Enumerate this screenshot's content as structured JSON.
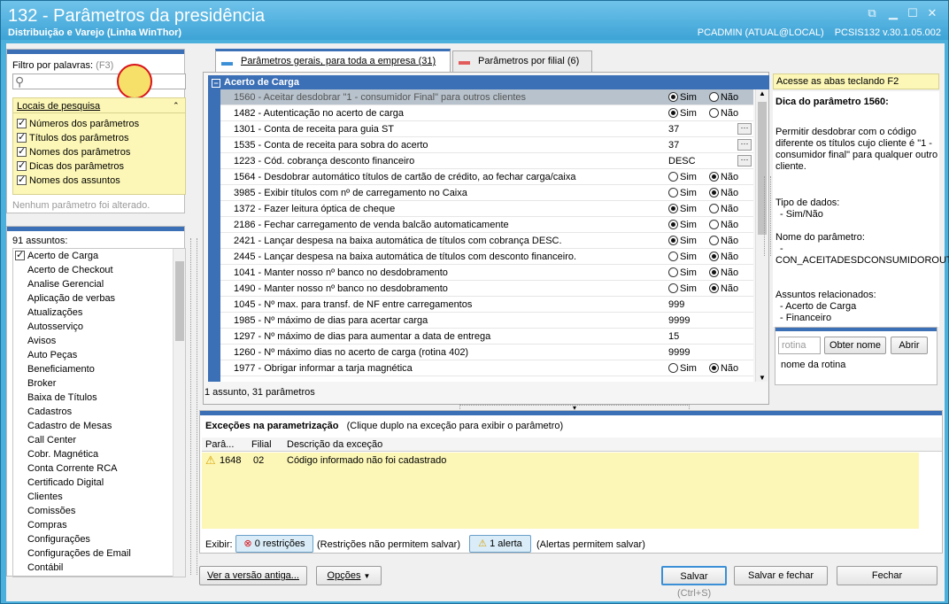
{
  "window": {
    "title": "132 - Parâmetros da presidência",
    "subtitle": "Distribuição e Varejo (Linha WinThor)",
    "user": "PCADMIN (ATUAL@LOCAL)",
    "version": "PCSIS132  v.30.1.05.002"
  },
  "filter": {
    "label": "Filtro por palavras:",
    "shortcut": "(F3)",
    "value": "",
    "locais_title": "Locais de pesquisa",
    "options": [
      {
        "label": "Números dos parâmetros",
        "checked": true
      },
      {
        "label": "Títulos dos parâmetros",
        "checked": true
      },
      {
        "label": "Nomes dos parâmetros",
        "checked": true
      },
      {
        "label": "Dicas dos parâmetros",
        "checked": true
      },
      {
        "label": "Nomes dos assuntos",
        "checked": true
      }
    ],
    "status": "Nenhum parâmetro foi alterado."
  },
  "subjects": {
    "count_label": "91 assuntos:",
    "items": [
      {
        "label": "Acerto de Carga",
        "checked": true
      },
      {
        "label": "Acerto de Checkout"
      },
      {
        "label": "Analise Gerencial"
      },
      {
        "label": "Aplicação de verbas"
      },
      {
        "label": "Atualizações"
      },
      {
        "label": "Autosserviço"
      },
      {
        "label": "Avisos"
      },
      {
        "label": "Auto Peças"
      },
      {
        "label": "Beneficiamento"
      },
      {
        "label": "Broker"
      },
      {
        "label": "Baixa de Títulos"
      },
      {
        "label": "Cadastros"
      },
      {
        "label": "Cadastro de Mesas"
      },
      {
        "label": "Call Center"
      },
      {
        "label": "Cobr. Magnética"
      },
      {
        "label": "Conta Corrente RCA"
      },
      {
        "label": "Certificado Digital"
      },
      {
        "label": "Clientes"
      },
      {
        "label": "Comissões"
      },
      {
        "label": "Compras"
      },
      {
        "label": "Configurações"
      },
      {
        "label": "Configurações de Email"
      },
      {
        "label": "Contábil"
      }
    ]
  },
  "tabs": [
    {
      "label": "Parâmetros gerais, para toda a empresa",
      "count": "(31)"
    },
    {
      "label": "Parâmetros por filial",
      "count": "(6)"
    }
  ],
  "params": {
    "group": "Acerto de Carga",
    "sim": "Sim",
    "nao": "Não",
    "rows": [
      {
        "name": "1560 - Aceitar desdobrar \"1 - consumidor Final\" para outros clientes",
        "type": "radio",
        "value": "Sim"
      },
      {
        "name": "1482 - Autenticação no acerto de carga",
        "type": "radio",
        "value": "Sim"
      },
      {
        "name": "1301 - Conta de receita para guia ST",
        "type": "text",
        "value": "37",
        "ellipsis": true
      },
      {
        "name": "1535 - Conta de receita para sobra do acerto",
        "type": "text",
        "value": "37",
        "ellipsis": true
      },
      {
        "name": "1223 - Cód. cobrança desconto financeiro",
        "type": "text",
        "value": "DESC",
        "ellipsis": true
      },
      {
        "name": "1564 - Desdobrar automático títulos de cartão de crédito, ao fechar carga/caixa",
        "type": "radio",
        "value": "Não"
      },
      {
        "name": "3985 - Exibir títulos com nº de carregamento no Caixa",
        "type": "radio",
        "value": "Não"
      },
      {
        "name": "1372 - Fazer leitura óptica de cheque",
        "type": "radio",
        "value": "Sim"
      },
      {
        "name": "2186 - Fechar carregamento de venda balcão automaticamente",
        "type": "radio",
        "value": "Sim"
      },
      {
        "name": "2421 - Lançar despesa na baixa automática de títulos com cobrança DESC.",
        "type": "radio",
        "value": "Sim"
      },
      {
        "name": "2445 - Lançar despesa na baixa automática de títulos com desconto financeiro.",
        "type": "radio",
        "value": "Não"
      },
      {
        "name": "1041 - Manter nosso nº banco no desdobramento",
        "type": "radio",
        "value": "Não"
      },
      {
        "name": "1490 - Manter nosso nº banco no desdobramento",
        "type": "radio",
        "value": "Não"
      },
      {
        "name": "1045 - Nº max. para transf. de NF entre carregamentos",
        "type": "text",
        "value": "999"
      },
      {
        "name": "1985 - Nº máximo de dias para acertar carga",
        "type": "text",
        "value": "9999"
      },
      {
        "name": "1297 - Nº máximo de dias para aumentar a data de entrega",
        "type": "text",
        "value": "15"
      },
      {
        "name": "1260 - Nº máximo dias no acerto de carga (rotina 402)",
        "type": "text",
        "value": "9999"
      },
      {
        "name": "1977 - Obrigar informar a tarja magnética",
        "type": "radio",
        "value": "Não"
      }
    ],
    "summary": "1 assunto, 31 parâmetros"
  },
  "help": {
    "banner": "Acesse as abas teclando F2",
    "title": "Dica do parâmetro 1560:",
    "desc": "Permitir desdobrar com o código diferente os títulos cujo cliente é \"1 - consumidor final\" para qualquer outro cliente.",
    "type_label": "Tipo de dados:",
    "type_value": "- Sim/Não",
    "name_label": "Nome do parâmetro:",
    "name_value": "-",
    "name_code": "CON_ACEITADESDCONSUMIDOROUT",
    "related_label": "Assuntos relacionados:",
    "related": [
      "- Acerto de Carga",
      "- Financeiro"
    ],
    "rotina_placeholder": "rotina",
    "obter_label": "Obter nome",
    "abrir_label": "Abrir",
    "rotina_name": "nome da rotina"
  },
  "exceptions": {
    "title": "Exceções na parametrização",
    "hint": "(Clique duplo na exceção para exibir o parâmetro)",
    "cols": [
      "Parâ...",
      "Filial",
      "Descrição da exceção"
    ],
    "rows": [
      {
        "param": "1648",
        "filial": "02",
        "desc": "Código informado não foi cadastrado"
      }
    ],
    "exibir": "Exibir:",
    "restricoes_btn": "0 restrições",
    "restricoes_note": "(Restrições não permitem salvar)",
    "alertas_btn": "1 alerta",
    "alertas_note": "(Alertas permitem salvar)"
  },
  "footer": {
    "old_version": "Ver a versão antiga...",
    "options": "Opções",
    "save": "Salvar",
    "save_shortcut": "(Ctrl+S)",
    "save_close": "Salvar e fechar",
    "close": "Fechar"
  }
}
